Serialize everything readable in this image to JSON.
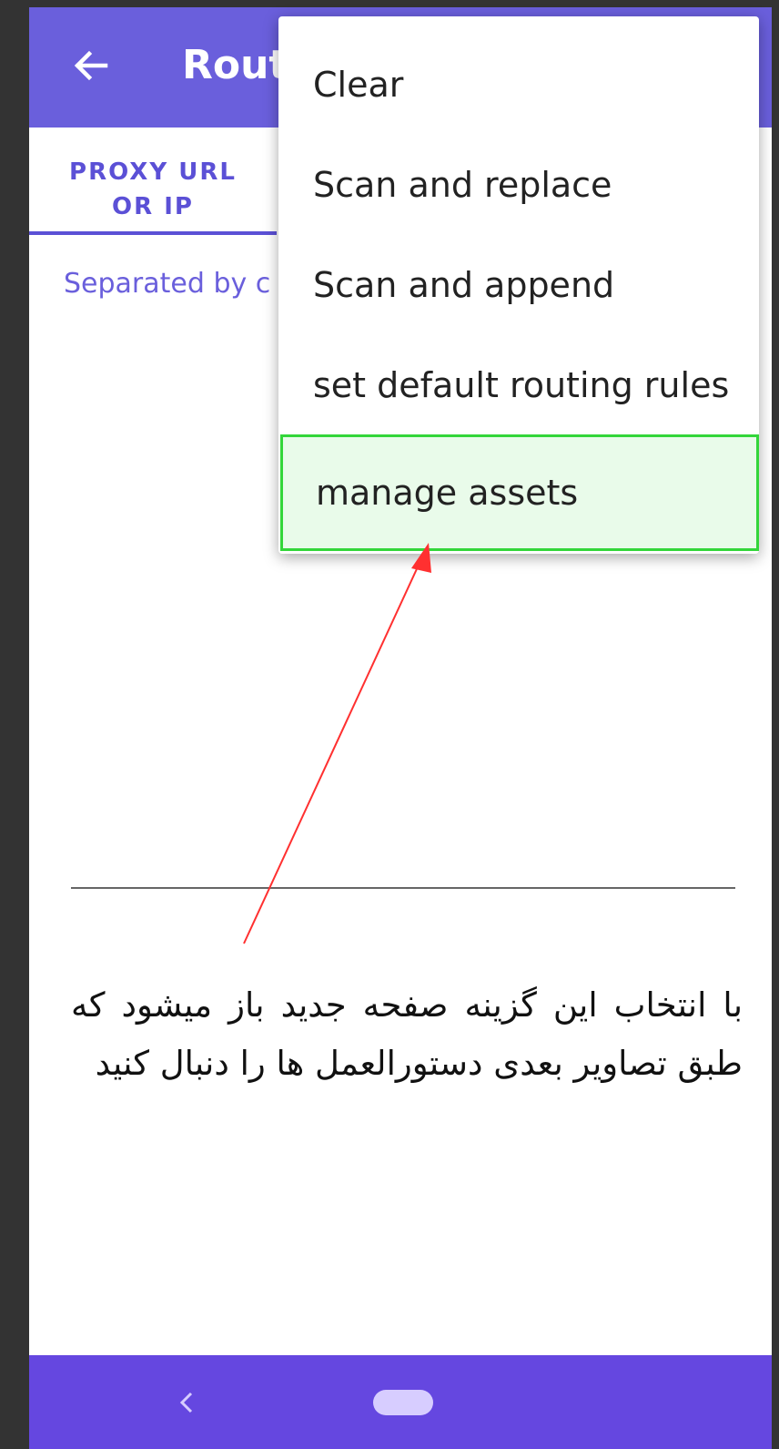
{
  "app_bar": {
    "title": "Rout",
    "background_color": "#6a5fdc",
    "back_icon": "arrow-left-icon"
  },
  "tabs": [
    {
      "label": "PROXY URL\nOR IP",
      "selected": true
    }
  ],
  "content": {
    "hint": "Separated by c"
  },
  "overflow_menu": {
    "items": [
      {
        "label": "Clear"
      },
      {
        "label": "Scan and replace"
      },
      {
        "label": "Scan and append"
      },
      {
        "label": "set default routing rules"
      },
      {
        "label": "manage assets",
        "highlighted": true
      }
    ],
    "highlight_color": "#33d63a"
  },
  "annotation": {
    "text": "با انتخاب این گزینه صفحه جدید باز میشود که طبق تصاویر بعدی دستورالعمل ها را دنبال کنید",
    "arrow_color": "#ff3030"
  },
  "nav_bar": {
    "background_color": "#6547e0",
    "icons": [
      "nav-back-icon",
      "nav-home-pill"
    ]
  }
}
